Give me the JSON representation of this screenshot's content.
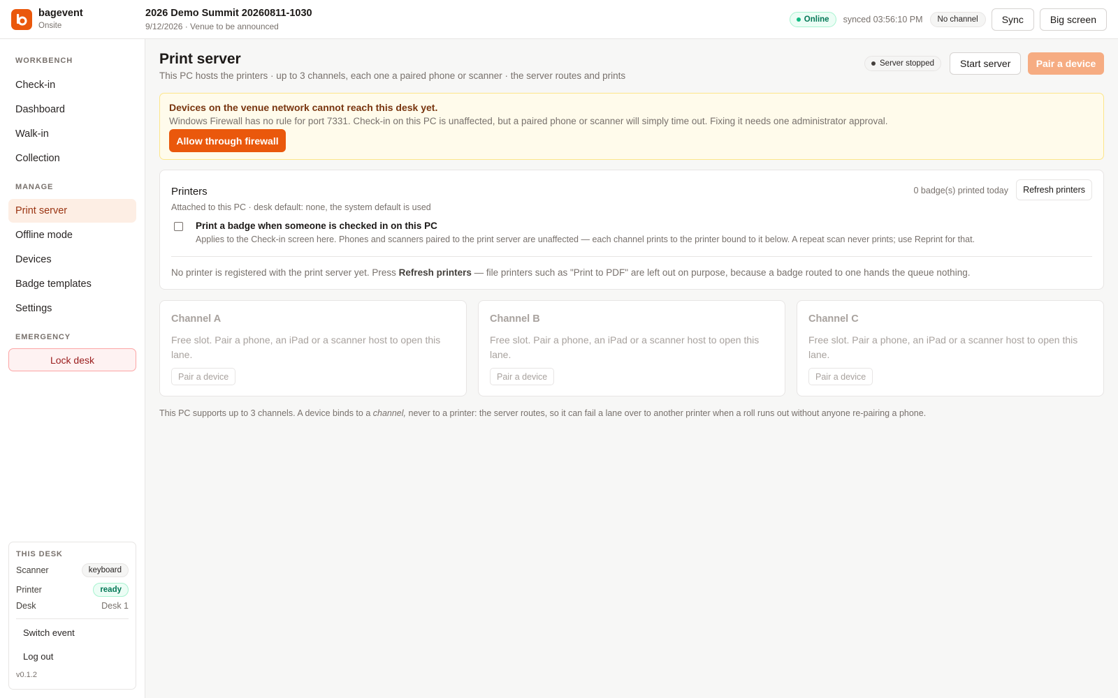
{
  "app": {
    "brand": "bagevent",
    "mode": "Onsite"
  },
  "event": {
    "title": "2026 Demo Summit 20260811-1030",
    "subtitle": "9/12/2026 · Venue to be announced"
  },
  "header": {
    "status": "Online",
    "synced": "synced 03:56:10 PM",
    "channel": "No channel",
    "sync_label": "Sync",
    "big_screen_label": "Big screen"
  },
  "sidebar": {
    "sections": {
      "workbench": "WORKBENCH",
      "manage": "MANAGE",
      "emergency": "EMERGENCY"
    },
    "workbench_items": [
      "Check-in",
      "Dashboard",
      "Walk-in",
      "Collection"
    ],
    "manage_items": [
      "Print server",
      "Offline mode",
      "Devices",
      "Badge templates",
      "Settings"
    ],
    "active_item": "Print server",
    "lock_label": "Lock desk",
    "desk": {
      "heading": "THIS DESK",
      "scanner_label": "Scanner",
      "scanner_value": "keyboard",
      "printer_label": "Printer",
      "printer_value": "ready",
      "desk_label": "Desk",
      "desk_value": "Desk 1",
      "switch_event": "Switch event",
      "log_out": "Log out",
      "version": "v0.1.2"
    }
  },
  "page": {
    "title": "Print server",
    "subtitle": "This PC hosts the printers · up to 3 channels, each one a paired phone or scanner · the server routes and prints",
    "server_status": "Server stopped",
    "start_label": "Start server",
    "pair_label": "Pair a device"
  },
  "alert": {
    "title": "Devices on the venue network cannot reach this desk yet.",
    "text": "Windows Firewall has no rule for port 7331. Check-in on this PC is unaffected, but a paired phone or scanner will simply time out. Fixing it needs one administrator approval.",
    "button": "Allow through firewall"
  },
  "printers": {
    "title": "Printers",
    "subtitle": "Attached to this PC · desk default: none, the system default is used",
    "count": "0 badge(s) printed today",
    "refresh_label": "Refresh printers",
    "checkbox_label": "Print a badge when someone is checked in on this PC",
    "checkbox_checked": false,
    "checkbox_help": "Applies to the Check-in screen here. Phones and scanners paired to the print server are unaffected — each channel prints to the printer bound to it below. A repeat scan never prints; use Reprint for that.",
    "note_before": "No printer is registered with the print server yet. Press ",
    "note_bold": "Refresh printers",
    "note_after": " — file printers such as \"Print to PDF\" are left out on purpose, because a badge routed to one hands the queue nothing."
  },
  "channels": [
    {
      "title": "Channel A",
      "text": "Free slot. Pair a phone, an iPad or a scanner host to open this lane.",
      "button": "Pair a device"
    },
    {
      "title": "Channel B",
      "text": "Free slot. Pair a phone, an iPad or a scanner host to open this lane.",
      "button": "Pair a device"
    },
    {
      "title": "Channel C",
      "text": "Free slot. Pair a phone, an iPad or a scanner host to open this lane.",
      "button": "Pair a device"
    }
  ],
  "footnote": {
    "before": "This PC supports up to 3 channels. A device binds to a ",
    "emphasis": "channel,",
    "after": " never to a printer: the server routes, so it can fail a lane over to another printer when a roll runs out without anyone re-pairing a phone."
  },
  "colors": {
    "accent": "#ea580c",
    "accent_soft": "#f6ac82",
    "online_green": "#10b981",
    "alert_bg": "#fffbeb",
    "danger": "#991b1b"
  },
  "icons": {
    "logo": "bagevent-logo-icon",
    "status_dot": "status-dot-icon"
  }
}
